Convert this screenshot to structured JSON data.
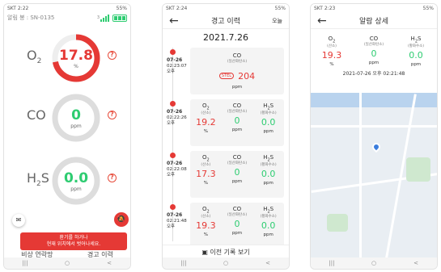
{
  "phone1": {
    "status_left": "SKT 2:22",
    "status_right": "55%",
    "device_label": "알림 봉 : SN-0135",
    "signal_num": "3",
    "gases": [
      {
        "name": "O",
        "sub": "2",
        "value": "17.8",
        "unit": "%",
        "ring_color": "#e53935",
        "value_color": "#e53935",
        "level": 0.72
      },
      {
        "name": "CO",
        "sub": "",
        "value": "0",
        "unit": "ppm",
        "ring_color": "#dddddd",
        "value_color": "#2ecc71",
        "level": 0
      },
      {
        "name": "H",
        "sub": "2",
        "name2": "S",
        "value": "0.0",
        "unit": "ppm",
        "ring_color": "#dddddd",
        "value_color": "#2ecc71",
        "level": 0
      }
    ],
    "alert_line1": "환기를 하거나",
    "alert_line2": "현재 위치에서 벗어나세요.",
    "bottom_left": "비상 연락망",
    "bottom_right": "경고 이력",
    "help_glyph": "?"
  },
  "phone2": {
    "status_left": "SKT 2:24",
    "status_right": "55%",
    "title": "경고 이력",
    "right_label": "오늘",
    "date": "2021.7.26",
    "entries": [
      {
        "date": "07-26",
        "time": "02:23:07",
        "ampm": "오후",
        "type": "co"
      },
      {
        "date": "07-26",
        "time": "02:22:26",
        "ampm": "오후",
        "type": "triple",
        "o2": "19.2",
        "co": "0",
        "h2s": "0.0"
      },
      {
        "date": "07-26",
        "time": "02:22:08",
        "ampm": "오후",
        "type": "triple",
        "o2": "17.3",
        "co": "0",
        "h2s": "0.0"
      },
      {
        "date": "07-26",
        "time": "02:21:48",
        "ampm": "오후",
        "type": "triple",
        "o2": "19.3",
        "co": "0",
        "h2s": "0.0"
      }
    ],
    "co_entry": {
      "name": "CO",
      "sub": "(일산화탄소)",
      "stel": "STEL",
      "value": "204",
      "unit": "ppm"
    },
    "labels": {
      "o2": "O",
      "o2_sub": "(산소)",
      "co": "CO",
      "co_sub": "(일산화탄소)",
      "h2s": "H",
      "h2s_s": "S",
      "h2s_sub": "(황화수소)",
      "pct": "%",
      "ppm": "ppm",
      "two": "2"
    },
    "prev_button": "이전 기록 보기"
  },
  "phone3": {
    "status_left": "SKT 2:23",
    "status_right": "55%",
    "title": "알람 상세",
    "o2": "19.3",
    "co": "0",
    "h2s": "0.0",
    "timestamp": "2021-07-26 오후 02:21:48"
  },
  "nav": {
    "back": "←",
    "recent": "|||",
    "home": "○",
    "return": "<"
  }
}
